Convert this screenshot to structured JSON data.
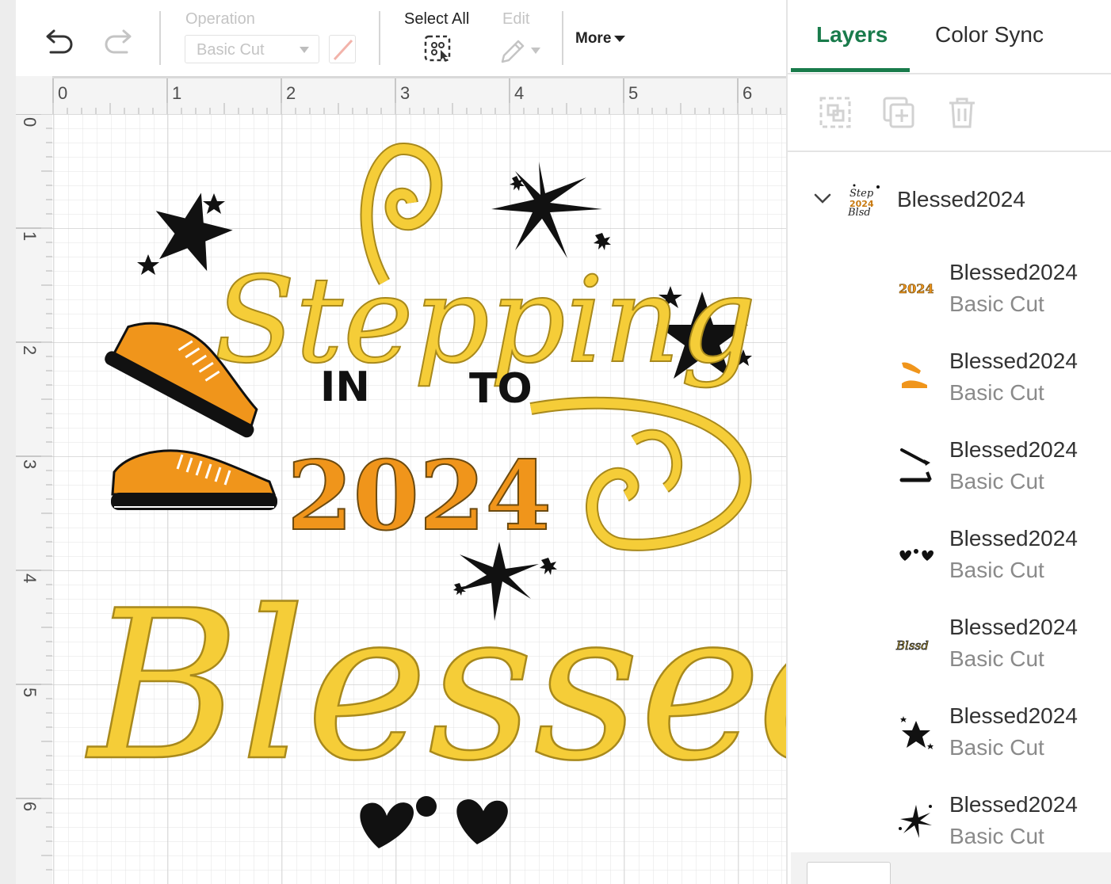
{
  "toolbar": {
    "undo_icon": "undo-icon",
    "redo_icon": "redo-icon",
    "operation_label": "Operation",
    "operation_value": "Basic Cut",
    "select_all_label": "Select All",
    "edit_label": "Edit",
    "more_label": "More"
  },
  "ruler": {
    "top": [
      "0",
      "1",
      "2",
      "3",
      "4",
      "5",
      "6"
    ],
    "left": [
      "0",
      "1",
      "2",
      "3",
      "4",
      "5",
      "6"
    ]
  },
  "design": {
    "line1": "Stepping",
    "line2a": "IN",
    "line2b": "TO",
    "line3": "2024",
    "line4": "Blessed",
    "colors": {
      "script_yellow": "#f5cd38",
      "script_outline": "#a8891c",
      "orange": "#f0951b",
      "black": "#111111"
    }
  },
  "panel": {
    "tabs": [
      {
        "label": "Layers",
        "active": true
      },
      {
        "label": "Color Sync",
        "active": false
      }
    ],
    "actions": [
      "group-icon",
      "duplicate-icon",
      "delete-icon"
    ],
    "group": {
      "name": "Blessed2024",
      "expanded": true
    },
    "layers": [
      {
        "name": "Blessed2024",
        "operation": "Basic Cut",
        "thumb": "2024-text-thumb"
      },
      {
        "name": "Blessed2024",
        "operation": "Basic Cut",
        "thumb": "orange-shoes-thumb"
      },
      {
        "name": "Blessed2024",
        "operation": "Basic Cut",
        "thumb": "shoe-soles-thumb"
      },
      {
        "name": "Blessed2024",
        "operation": "Basic Cut",
        "thumb": "hearts-thumb"
      },
      {
        "name": "Blessed2024",
        "operation": "Basic Cut",
        "thumb": "blessed-text-thumb"
      },
      {
        "name": "Blessed2024",
        "operation": "Basic Cut",
        "thumb": "stars-thumb"
      },
      {
        "name": "Blessed2024",
        "operation": "Basic Cut",
        "thumb": "sparkles-thumb"
      }
    ]
  }
}
